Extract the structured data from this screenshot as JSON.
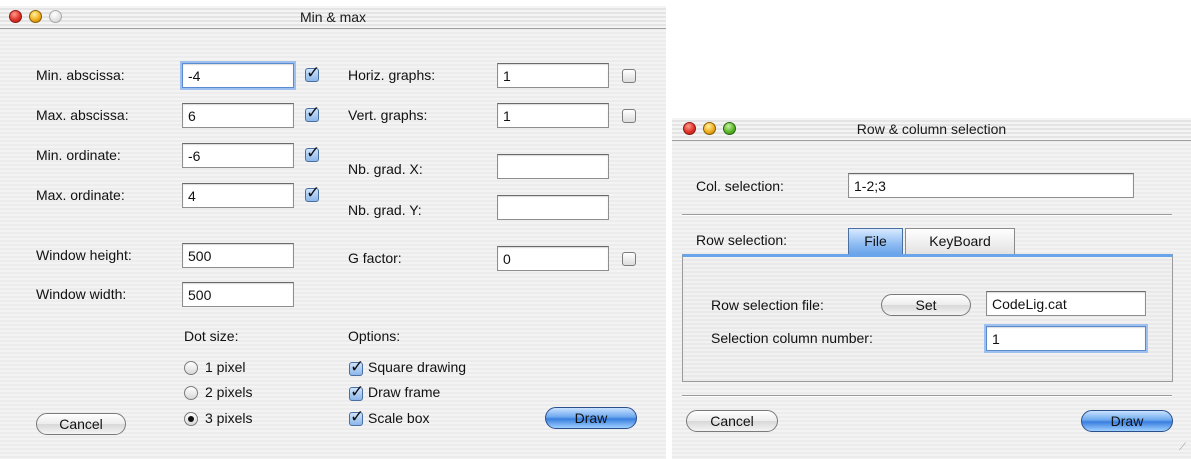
{
  "minmax": {
    "title": "Min & max",
    "fields": [
      {
        "label": "Min. abscissa:",
        "value": "-4",
        "checked": true
      },
      {
        "label": "Max. abscissa:",
        "value": "6",
        "checked": true
      },
      {
        "label": "Min. ordinate:",
        "value": "-6",
        "checked": true
      },
      {
        "label": "Max. ordinate:",
        "value": "4",
        "checked": true
      }
    ],
    "graphs": [
      {
        "label": "Horiz. graphs:",
        "value": "1",
        "checked": false
      },
      {
        "label": "Vert. graphs:",
        "value": "1",
        "checked": false
      },
      {
        "label": "Nb. grad. X:",
        "value": ""
      },
      {
        "label": "Nb. grad. Y:",
        "value": ""
      },
      {
        "label": "G factor:",
        "value": "0",
        "checked": false
      }
    ],
    "window_height": {
      "label": "Window height:",
      "value": "500"
    },
    "window_width": {
      "label": "Window width:",
      "value": "500"
    },
    "dot_size": {
      "label": "Dot size:",
      "options": [
        "1 pixel",
        "2 pixels",
        "3 pixels"
      ],
      "selected": "3 pixels"
    },
    "options": {
      "label": "Options:",
      "items": [
        {
          "label": "Square drawing",
          "checked": true
        },
        {
          "label": "Draw frame",
          "checked": true
        },
        {
          "label": "Scale box",
          "checked": true
        }
      ]
    },
    "cancel_label": "Cancel",
    "draw_label": "Draw"
  },
  "rowcol": {
    "title": "Row & column selection",
    "col_selection": {
      "label": "Col. selection:",
      "value": "1-2;3"
    },
    "row_selection_label": "Row selection:",
    "tabs": [
      "File",
      "KeyBoard"
    ],
    "active_tab": "File",
    "row_file": {
      "label": "Row selection file:",
      "button": "Set",
      "value": "CodeLig.cat"
    },
    "sel_column": {
      "label": "Selection column number:",
      "value": "1"
    },
    "cancel_label": "Cancel",
    "draw_label": "Draw"
  },
  "colors": {
    "accent": "#3a7ee0",
    "tab_active": "#6aa4ea"
  }
}
